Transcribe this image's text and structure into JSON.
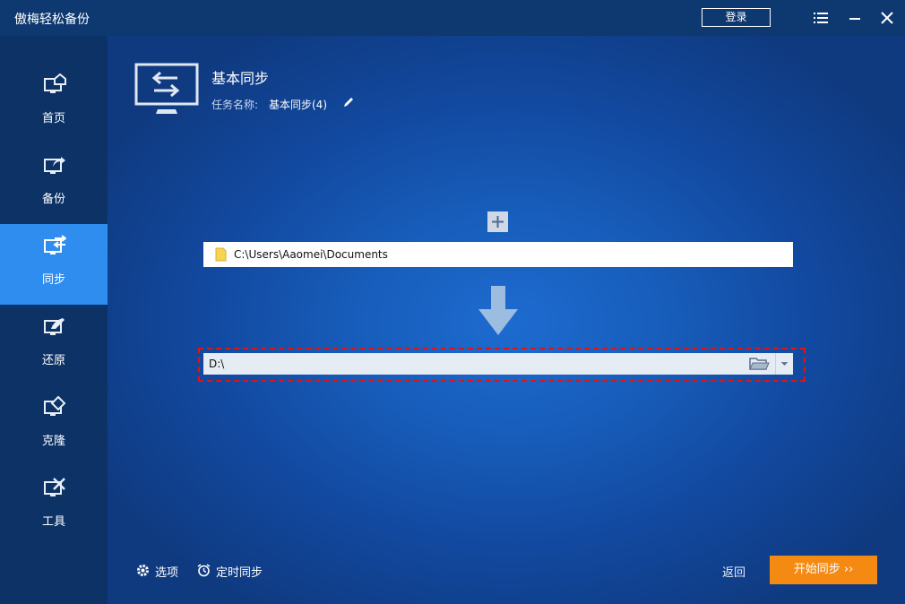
{
  "window": {
    "title": "傲梅轻松备份",
    "login_label": "登录",
    "menu_icon": "menu-icon",
    "minimize_icon": "minimize-icon",
    "close_icon": "close-icon"
  },
  "sidebar": {
    "items": [
      {
        "label": "首页",
        "icon": "home-icon",
        "active": false
      },
      {
        "label": "备份",
        "icon": "backup-icon",
        "active": false
      },
      {
        "label": "同步",
        "icon": "sync-icon",
        "active": true
      },
      {
        "label": "还原",
        "icon": "restore-icon",
        "active": false
      },
      {
        "label": "克隆",
        "icon": "clone-icon",
        "active": false
      },
      {
        "label": "工具",
        "icon": "tools-icon",
        "active": false
      }
    ]
  },
  "task": {
    "title": "基本同步",
    "name_label": "任务名称:",
    "name_value": "基本同步(4)"
  },
  "source": {
    "path": "C:\\Users\\Aaomei\\Documents"
  },
  "destination": {
    "path": "D:\\"
  },
  "footer": {
    "options_label": "选项",
    "schedule_label": "定时同步",
    "back_label": "返回",
    "start_label": "开始同步 ››"
  },
  "colors": {
    "accent": "#2f8df0",
    "start_button": "#f58a12",
    "highlight_border": "#e01414"
  }
}
